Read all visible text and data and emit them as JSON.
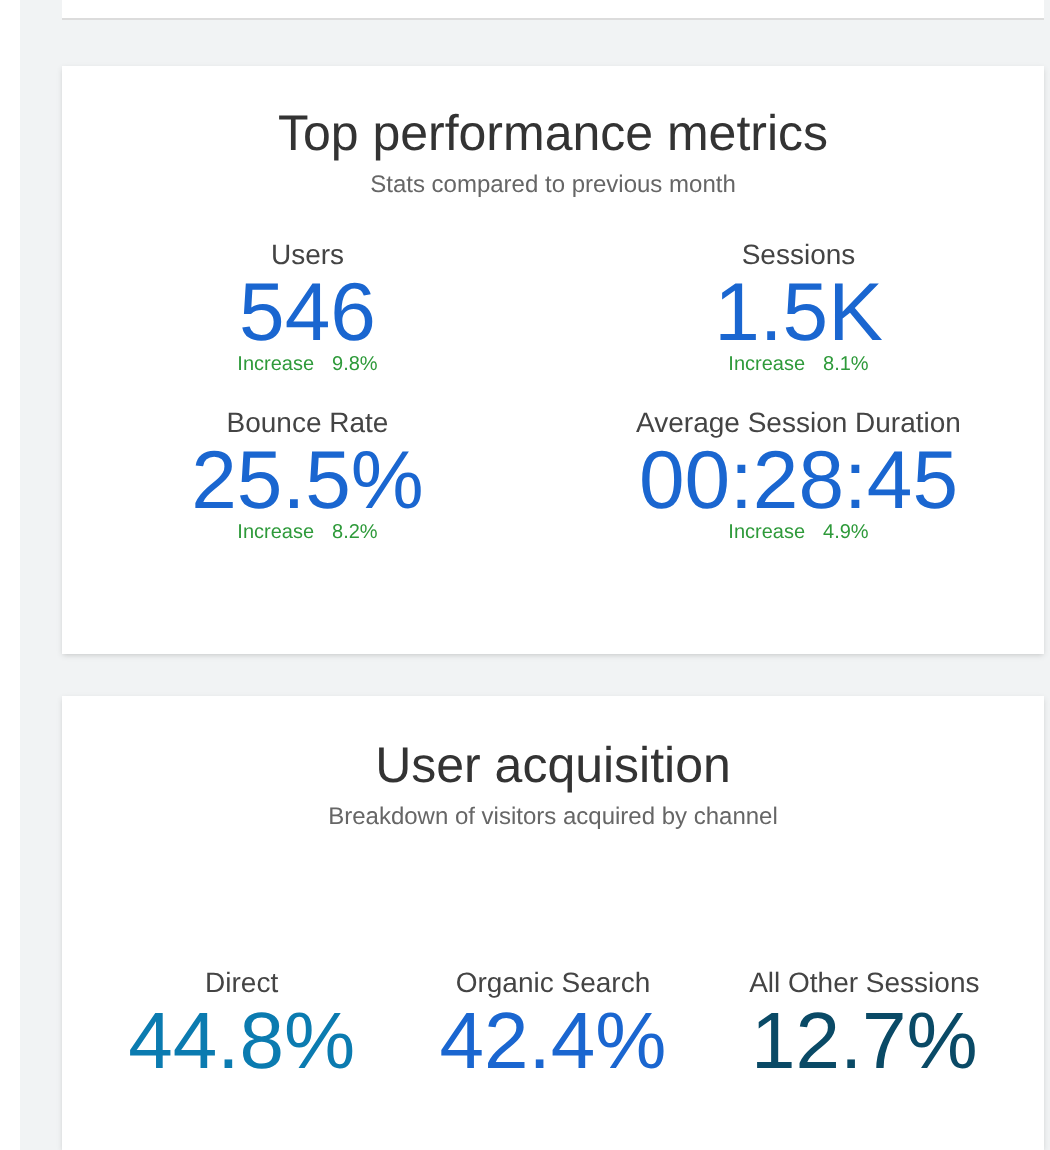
{
  "performance": {
    "title": "Top performance metrics",
    "subtitle": "Stats compared to previous month",
    "metrics": [
      {
        "label": "Users",
        "value": "546",
        "change_label": "Increase",
        "change": "9.8%"
      },
      {
        "label": "Sessions",
        "value": "1.5K",
        "change_label": "Increase",
        "change": "8.1%"
      },
      {
        "label": "Bounce Rate",
        "value": "25.5%",
        "change_label": "Increase",
        "change": "8.2%"
      },
      {
        "label": "Average Session Duration",
        "value": "00:28:45",
        "change_label": "Increase",
        "change": "4.9%"
      }
    ]
  },
  "acquisition": {
    "title": "User acquisition",
    "subtitle": "Breakdown of visitors acquired by channel",
    "channels": [
      {
        "label": "Direct",
        "value": "44.8%",
        "color": "#0b7bb0"
      },
      {
        "label": "Organic Search",
        "value": "42.4%",
        "color": "#1a66d0"
      },
      {
        "label": "All Other Sessions",
        "value": "12.7%",
        "color": "#0a4a66"
      }
    ]
  }
}
